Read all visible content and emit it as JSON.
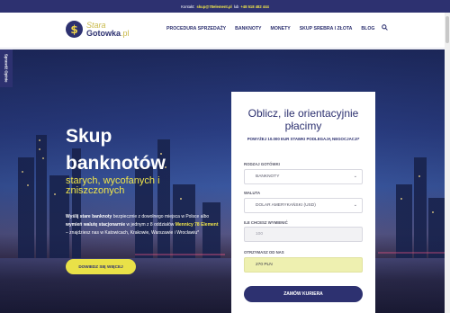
{
  "topbar": {
    "prefix": "Kontakt:",
    "email": "skup@78element.pl",
    "sep": "lub",
    "phone": "+48 518 482 444"
  },
  "logo": {
    "line1": "Stara",
    "line2": "Gotowka",
    "tld": ".pl",
    "icon": "dollar-coin-icon"
  },
  "nav": {
    "items": [
      "PROCEDURA SPRZEDAŻY",
      "BANKNOTY",
      "MONETY",
      "SKUP SREBRA I ZŁOTA",
      "BLOG"
    ],
    "search_icon": "search-icon"
  },
  "side_tab": "Sprawdź Opinie",
  "hero": {
    "title_line1": "Skup",
    "title_line2": "banknotów",
    "subtitle": "starych, wycofanych i zniszczonych",
    "desc_1": "Wyślij stare banknoty",
    "desc_2": " bezpiecznie z dowolnego miejsca w Polsce albo ",
    "desc_3": "wymień walutę stacjonarnie",
    "desc_4": " w jednym z 8 oddziałów ",
    "desc_5": "Mennicy 78 Element",
    "desc_6": " – znajdziesz nas w Katowicach, Krakowie, Warszawie i Wrocławiu*",
    "button": "DOWIEDZ SIĘ WIĘCEJ"
  },
  "form": {
    "title": "Oblicz, ile orientacyjnie płacimy",
    "note": "POWYŻEJ 10.000 EUR STAWKI PODLEGAJĄ NEGOCJACJI*",
    "type_label": "RODZAJ GOTÓWKI",
    "type_value": "BANKNOTY",
    "currency_label": "WALUTA",
    "currency_value": "DOLAR AMERYKAŃSKI (USD)",
    "amount_label": "ILE CHCESZ WYMIENIĆ",
    "amount_placeholder": "100",
    "receive_label": "OTRZYMASZ OD NAS",
    "receive_value": "270 PLN",
    "button": "ZAMÓW KURIERA"
  }
}
